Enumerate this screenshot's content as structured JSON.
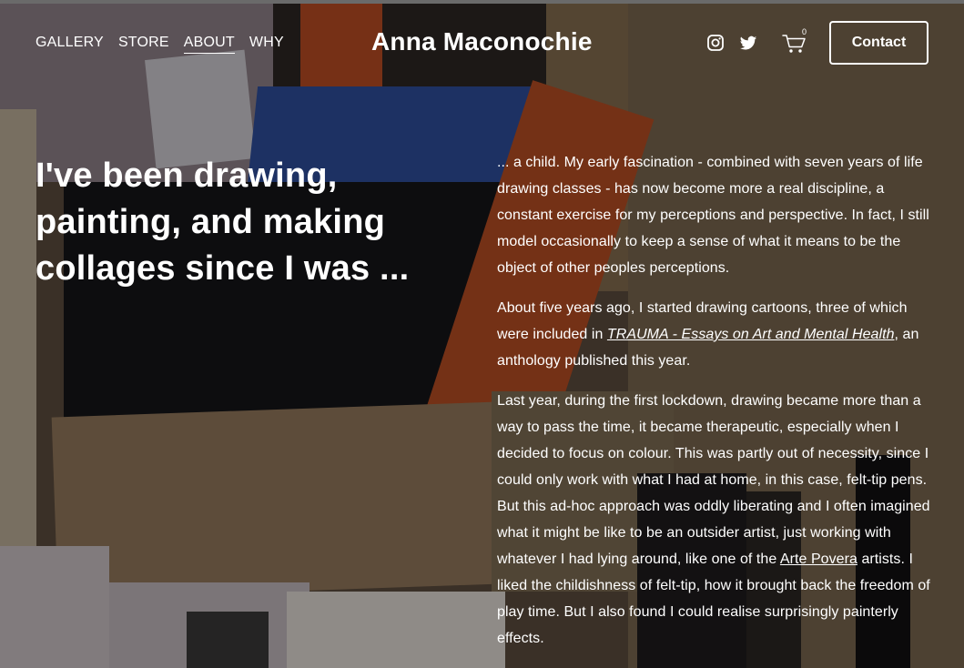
{
  "nav": {
    "items": [
      {
        "label": "GALLERY",
        "active": false
      },
      {
        "label": "STORE",
        "active": false
      },
      {
        "label": "ABOUT",
        "active": true
      },
      {
        "label": "WHY",
        "active": false
      }
    ]
  },
  "site_title": "Anna Maconochie",
  "header": {
    "social_icons": [
      "instagram-icon",
      "twitter-icon"
    ],
    "cart_count": "0",
    "contact_label": "Contact"
  },
  "main": {
    "headline": "I've been drawing, painting, and making collages since I was ...",
    "paragraphs": [
      {
        "text": "... a child. My early fascination - combined with seven years of life drawing classes - has now become more a real discipline, a constant exercise for my perceptions and perspective. In fact, I still model occasionally to keep a sense of what it means to be the object of other peoples perceptions."
      },
      {
        "before": "About five years ago, I started drawing cartoons, three of which were included in ",
        "link": "TRAUMA - Essays on Art and Mental Health",
        "after": ", an anthology published this year."
      },
      {
        "before": "Last year, during the first lockdown, drawing became more than a way to pass the time, it became therapeutic, especially when I decided to focus on colour. This was partly out of necessity, since I could only work with what I had at home, in this case, felt-tip pens. But this ad-hoc approach was oddly liberating and I often imagined what it might be like to be an outsider artist, just working with whatever I had lying around, like one of the ",
        "link": "Arte Povera",
        "after": " artists. I liked the childishness of felt-tip, how it brought back the freedom of play time. But I also found I could realise surprisingly painterly effects."
      }
    ]
  },
  "colors": {
    "text": "#ffffff",
    "overlay": "#000000"
  }
}
